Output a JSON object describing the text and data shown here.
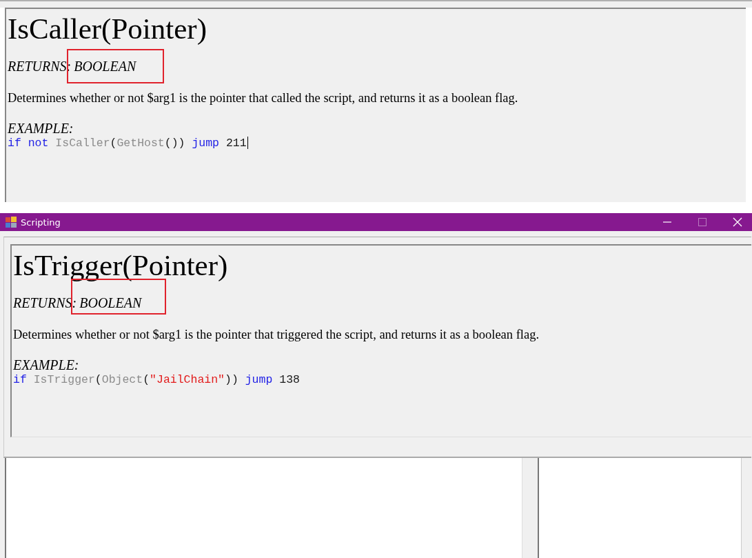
{
  "snippet": {
    "title": "IsCaller(Pointer)",
    "returns_label": "RETURNS:",
    "returns_type": "BOOLEAN",
    "highlighted": true,
    "description": "Determines whether or not $arg1 is the pointer that called the script, and returns it as a boolean flag.",
    "example_label": "EXAMPLE:",
    "cursor": true,
    "code": [
      {
        "kind": "keyword",
        "text": "if "
      },
      {
        "kind": "keyword",
        "text": "not "
      },
      {
        "kind": "function",
        "text": "IsCaller"
      },
      {
        "kind": "plain",
        "text": "("
      },
      {
        "kind": "function",
        "text": "GetHost"
      },
      {
        "kind": "plain",
        "text": "()) "
      },
      {
        "kind": "keyword",
        "text": "jump"
      },
      {
        "kind": "plain",
        "text": " 211"
      }
    ]
  },
  "window": {
    "title": "Scripting",
    "doc": {
      "title": "IsTrigger(Pointer)",
      "returns_label": "RETURNS:",
      "returns_type": "BOOLEAN",
      "highlighted": true,
      "description": "Determines whether or not $arg1 is the pointer that triggered the script, and returns it as a boolean flag.",
      "example_label": "EXAMPLE:",
      "code": [
        {
          "kind": "keyword",
          "text": "if "
        },
        {
          "kind": "function",
          "text": "IsTrigger"
        },
        {
          "kind": "plain",
          "text": "("
        },
        {
          "kind": "function",
          "text": "Object"
        },
        {
          "kind": "plain",
          "text": "("
        },
        {
          "kind": "string",
          "text": "\"JailChain\""
        },
        {
          "kind": "plain",
          "text": ")) "
        },
        {
          "kind": "keyword",
          "text": "jump"
        },
        {
          "kind": "plain",
          "text": " 138"
        }
      ]
    }
  }
}
